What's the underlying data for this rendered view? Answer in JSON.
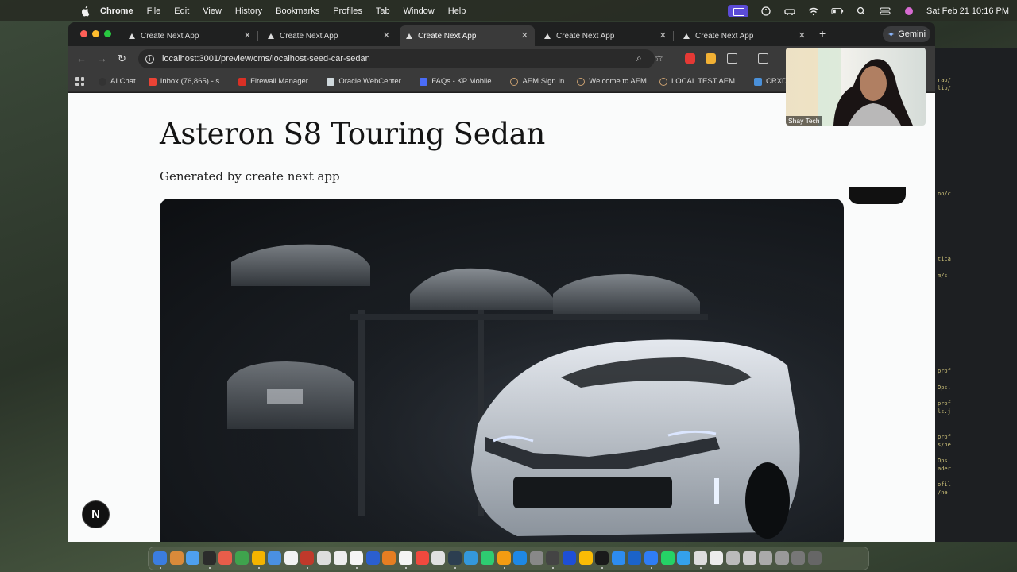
{
  "menubar": {
    "app_name": "Chrome",
    "items": [
      "File",
      "Edit",
      "View",
      "History",
      "Bookmarks",
      "Profiles",
      "Tab",
      "Window",
      "Help"
    ],
    "datetime": "Sat Feb 21  10:16 PM"
  },
  "browser": {
    "tabs": [
      {
        "title": "Create Next App",
        "active": false
      },
      {
        "title": "Create Next App",
        "active": false
      },
      {
        "title": "Create Next App",
        "active": true
      },
      {
        "title": "Create Next App",
        "active": false
      },
      {
        "title": "Create Next App",
        "active": false
      }
    ],
    "gemini_label": "Gemini",
    "url": "localhost:3001/preview/cms/localhost-seed-car-sedan",
    "bookmarks": [
      {
        "label": "AI Chat",
        "color": "#333333"
      },
      {
        "label": "Inbox (76,865) - s...",
        "color": "#ea4335"
      },
      {
        "label": "Firewall Manager...",
        "color": "#d93025"
      },
      {
        "label": "Oracle WebCenter...",
        "color": "#e0e0e0"
      },
      {
        "label": "FAQs - KP Mobile...",
        "color": "#4a6cf7"
      },
      {
        "label": "AEM Sign In",
        "color": "#3a3a3a"
      },
      {
        "label": "Welcome to AEM",
        "color": "#3a3a3a"
      },
      {
        "label": "LOCAL TEST AEM...",
        "color": "#3a3a3a"
      },
      {
        "label": "CRXDE Lite",
        "color": "#4a90d9"
      }
    ]
  },
  "page": {
    "title": "Asteron S8 Touring Sedan",
    "subtitle": "Generated by create next app",
    "next_badge": "N"
  },
  "video_call": {
    "participant": "Shay Tech"
  },
  "terminal_lines": [
    "rao/",
    "lib/",
    "no/c",
    "tica",
    "m/s",
    "prof",
    "Ops,",
    "prof",
    "ls.j",
    "prof",
    "s/ne",
    "Ops,",
    "ader",
    "ofil",
    "/ne"
  ],
  "dock": {
    "icon_colors": [
      "#3b7de0",
      "#d98a3a",
      "#4ea0f0",
      "#2b2b2b",
      "#e85d4a",
      "#3fa34d",
      "#f4b400",
      "#4a90e2",
      "#f2f2f2",
      "#c0392b",
      "#ddd",
      "#eee",
      "#f5f5f5",
      "#2b5fd0",
      "#e67e22",
      "#f4f4f4",
      "#f0493e",
      "#e0e0e0",
      "#2c3e50",
      "#3498db",
      "#2ecc71",
      "#f39c12",
      "#1e88e5",
      "#888",
      "#444",
      "#1e4fd6",
      "#fbbc05",
      "#1a1a1a",
      "#2d8cf0",
      "#1b63c9",
      "#2f7df5",
      "#25d366",
      "#34a1eb",
      "#dddddd",
      "#ececec",
      "#bbbbbb",
      "#cccccc",
      "#aaaaaa",
      "#999999",
      "#777777",
      "#666666"
    ]
  }
}
